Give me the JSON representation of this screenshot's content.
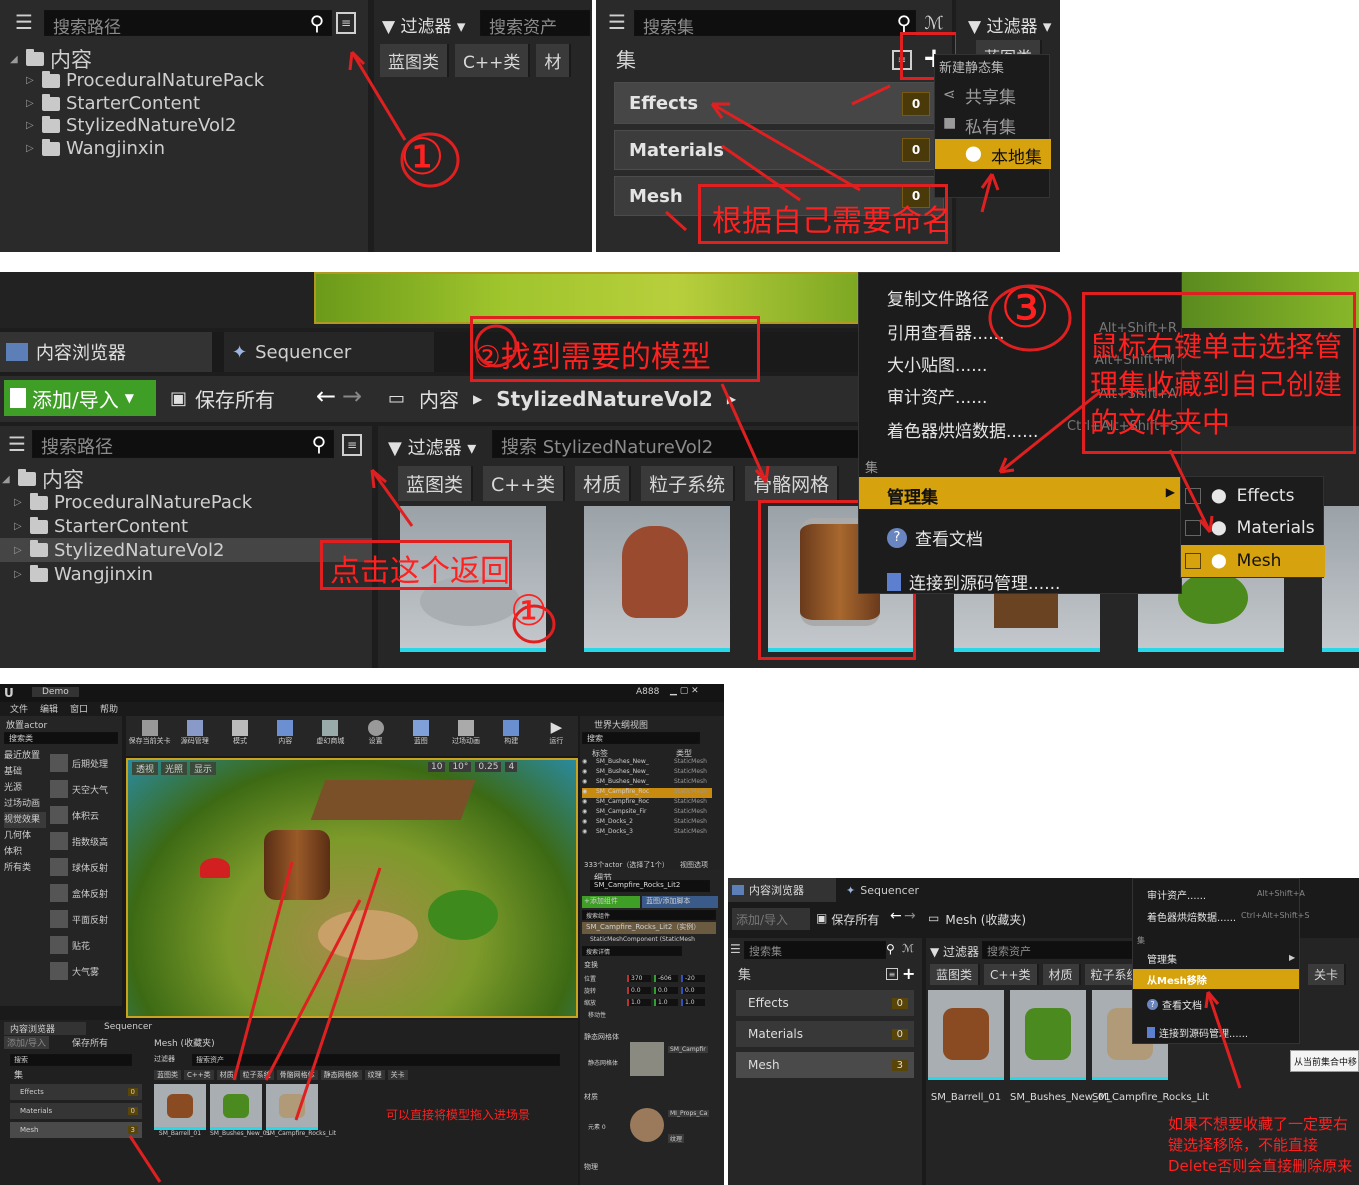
{
  "panel1": {
    "search_path_placeholder": "搜索路径",
    "filter_label": "过滤器",
    "search_assets_placeholder": "搜索资产",
    "tree_root": "内容",
    "tree_items": [
      "ProceduralNaturePack",
      "StarterContent",
      "StylizedNatureVol2",
      "Wangjinxin"
    ],
    "filter_chips": [
      "蓝图类",
      "C++类",
      "材"
    ],
    "annotation_number": "①"
  },
  "panel2": {
    "search_collections_placeholder": "搜索集",
    "collections_header": "集",
    "filter_label": "过滤器",
    "filter_chip_partial": "蓝图类",
    "new_collection_tooltip": "新建静态集",
    "collections": [
      {
        "name": "Effects",
        "count": "0"
      },
      {
        "name": "Materials",
        "count": "0"
      },
      {
        "name": "Mesh",
        "count": "0"
      }
    ],
    "dropdown": [
      {
        "label": "共享集",
        "icon": "share-icon"
      },
      {
        "label": "私有集",
        "icon": "lock-icon"
      },
      {
        "label": "本地集",
        "icon": "pin-icon"
      }
    ],
    "annotation": "根据自己需要命名"
  },
  "panel3": {
    "tabs": [
      "内容浏览器",
      "Sequencer"
    ],
    "add_import": "添加/导入",
    "save_all": "保存所有",
    "breadcrumb": [
      "内容",
      "StylizedNatureVol2"
    ],
    "search_path_placeholder": "搜索路径",
    "filter_label": "过滤器",
    "search_folder_placeholder": "搜索 StylizedNatureVol2",
    "tree_root": "内容",
    "tree_items": [
      "ProceduralNaturePack",
      "StarterContent",
      "StylizedNatureVol2",
      "Wangjinxin"
    ],
    "filter_chips": [
      "蓝图类",
      "C++类",
      "材质",
      "粒子系统",
      "骨骼网格"
    ],
    "context_menu": [
      {
        "label": "复制文件路径",
        "shortcut": ""
      },
      {
        "label": "引用查看器......",
        "shortcut": "Alt+Shift+R"
      },
      {
        "label": "大小贴图......",
        "shortcut": "Alt+Shift+M"
      },
      {
        "label": "审计资产......",
        "shortcut": "Alt+Shift+A"
      },
      {
        "label": "着色器烘焙数据......",
        "shortcut": "Ctrl+Alt+Shift+S"
      }
    ],
    "context_section": "集",
    "manage_collections": "管理集",
    "view_docs": "查看文档",
    "connect_source_control": "连接到源码管理......",
    "submenu": [
      {
        "label": "Effects",
        "checked": false
      },
      {
        "label": "Materials",
        "checked": false
      },
      {
        "label": "Mesh",
        "checked": true
      }
    ],
    "annotation_find": "②找到需要的模型",
    "annotation_back": "点击这个返回",
    "annotation_right_click": "鼠标右键单击选择管理集收藏到自己创建的文件夹中",
    "annotation_number1": "①",
    "annotation_number3": "③"
  },
  "panel4": {
    "window_title": "Demo",
    "project_name": "A888",
    "menu_bar": [
      "文件",
      "编辑",
      "窗口",
      "帮助"
    ],
    "modes_tab": "放置actor",
    "search_classes": "搜索类",
    "left_categories": [
      "最近放置",
      "基础",
      "光源",
      "过场动画",
      "视觉效果",
      "几何体",
      "体积",
      "所有类"
    ],
    "visual_effects_items": [
      "后期处理",
      "天空大气",
      "体积云",
      "指数级高",
      "球体反射",
      "盒体反射",
      "平面反射",
      "贴花",
      "大气雾"
    ],
    "toolbar": [
      "保存当前关卡",
      "源码管理",
      "模式",
      "内容",
      "虚幻商城",
      "设置",
      "蓝图",
      "过场动画",
      "构建",
      "运行"
    ],
    "viewport_buttons": [
      "透视",
      "光照",
      "显示"
    ],
    "viewport_numbers": [
      "10",
      "10°",
      "0.25",
      "4"
    ],
    "outliner_title": "世界大纲视图",
    "outliner_search": "搜索",
    "outliner_columns": [
      "标签",
      "类型"
    ],
    "outliner_rows": [
      {
        "label": "SM_Bushes_New_",
        "type": "StaticMesh"
      },
      {
        "label": "SM_Bushes_New_",
        "type": "StaticMesh"
      },
      {
        "label": "SM_Bushes_New_",
        "type": "StaticMesh"
      },
      {
        "label": "SM_Campfire_Roc",
        "type": "StaticMesh"
      },
      {
        "label": "SM_Campfire_Roc",
        "type": "StaticMesh"
      },
      {
        "label": "SM_Campsite_Fir",
        "type": "StaticMesh"
      },
      {
        "label": "SM_Docks_2",
        "type": "StaticMesh"
      },
      {
        "label": "SM_Docks_3",
        "type": "StaticMesh"
      }
    ],
    "outliner_footer": "333个actor（选择了1个）",
    "view_options": "视图选项",
    "details_title": "细节",
    "details_name": "SM_Campfire_Rocks_Lit2",
    "add_component": "+添加组件",
    "blueprint_add_script": "蓝图/添加脚本",
    "search_components": "搜索组件",
    "component_instance": "SM_Campfire_Rocks_Lit2（实例）",
    "static_mesh_component": "StaticMeshComponent (StaticMesh",
    "search_details": "搜索详情",
    "transform_section": "变换",
    "transform_rows": [
      {
        "label": "位置",
        "values": [
          "370",
          "-606",
          "-20"
        ]
      },
      {
        "label": "旋转",
        "values": [
          "0.0",
          "0.0",
          "0.0"
        ]
      },
      {
        "label": "缩放",
        "values": [
          "1.0",
          "1.0",
          "1.0"
        ]
      }
    ],
    "mobility_label": "移动性",
    "static_mesh_section": "静态网格体",
    "static_mesh_label": "静态网格体",
    "static_mesh_value": "SM_Campfir",
    "materials_section": "材质",
    "element0_label": "元素 0",
    "material_value": "MI_Props_Ca",
    "texture_label": "纹理",
    "physics_section": "物理",
    "cb_tabs": [
      "内容浏览器",
      "Sequencer"
    ],
    "cb_add_import": "添加/导入",
    "cb_save_all": "保存所有",
    "cb_path": "Mesh (收藏夹)",
    "cb_search": "搜索",
    "cb_filter": "过滤器",
    "cb_search_assets": "搜索资产",
    "cb_collections_header": "集",
    "cb_collections": [
      {
        "name": "Effects",
        "count": "0"
      },
      {
        "name": "Materials",
        "count": "0"
      },
      {
        "name": "Mesh",
        "count": "3"
      }
    ],
    "cb_filter_chips": [
      "蓝图类",
      "C++类",
      "材质",
      "粒子系统",
      "骨骼网格体",
      "静态网格体",
      "纹理",
      "关卡"
    ],
    "cb_assets": [
      "SM_Barrell_01",
      "SM_Bushes_New_01",
      "SM_Campfire_Rocks_Lit"
    ],
    "annotation_drag": "可以直接将模型拖入进场景"
  },
  "panel5": {
    "tabs": [
      "内容浏览器",
      "Sequencer"
    ],
    "add_import": "添加/导入",
    "save_all": "保存所有",
    "path": "Mesh (收藏夹)",
    "search_collections": "搜索集",
    "filter_label": "过滤器",
    "search_assets": "搜索资产",
    "collections_header": "集",
    "collections": [
      {
        "name": "Effects",
        "count": "0"
      },
      {
        "name": "Materials",
        "count": "0"
      },
      {
        "name": "Mesh",
        "count": "3"
      }
    ],
    "filter_chips": [
      "蓝图类",
      "C++类",
      "材质",
      "粒子系统"
    ],
    "extra_chip": "关卡",
    "assets": [
      "SM_Barrell_01",
      "SM_Bushes_New_01",
      "SM_Campfire_Rocks_Lit"
    ],
    "context_menu": [
      {
        "label": "审计资产......",
        "shortcut": "Alt+Shift+A"
      },
      {
        "label": "着色器烘焙数据......",
        "shortcut": "Ctrl+Alt+Shift+S"
      }
    ],
    "context_section": "集",
    "manage_collections": "管理集",
    "remove_from": "从Mesh移除",
    "view_docs": "查看文档",
    "connect_source_control": "连接到源码管理......",
    "tooltip": "从当前集合中移",
    "annotation": "如果不想要收藏了一定要右键选择移除，不能直接Delete否则会直接删除原来"
  },
  "colors": {
    "accent_gold": "#d6a20e",
    "annotation_red": "#ff2020",
    "asset_underline": "#28d8e8",
    "add_green": "#3f9e26"
  }
}
